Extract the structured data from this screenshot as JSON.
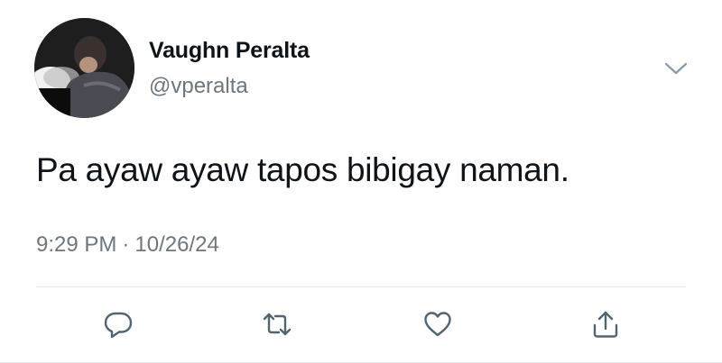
{
  "tweet": {
    "author": {
      "display_name": "Vaughn Peralta",
      "handle": "@vperalta",
      "avatar_icon": "profile-photo"
    },
    "text": "Pa ayaw ayaw tapos bibigay naman.",
    "time": "9:29 PM",
    "separator": "·",
    "date": "10/26/24",
    "menu_icon": "chevron-down-icon"
  },
  "actions": [
    {
      "name": "reply",
      "icon": "speech-bubble-icon"
    },
    {
      "name": "retweet",
      "icon": "retweet-arrows-icon"
    },
    {
      "name": "like",
      "icon": "heart-icon"
    },
    {
      "name": "share",
      "icon": "share-upload-icon"
    }
  ],
  "colors": {
    "text": "#0f1419",
    "secondary": "#6e767d",
    "icon": "#536471",
    "divider": "#e4e7ea",
    "background": "#ffffff"
  }
}
